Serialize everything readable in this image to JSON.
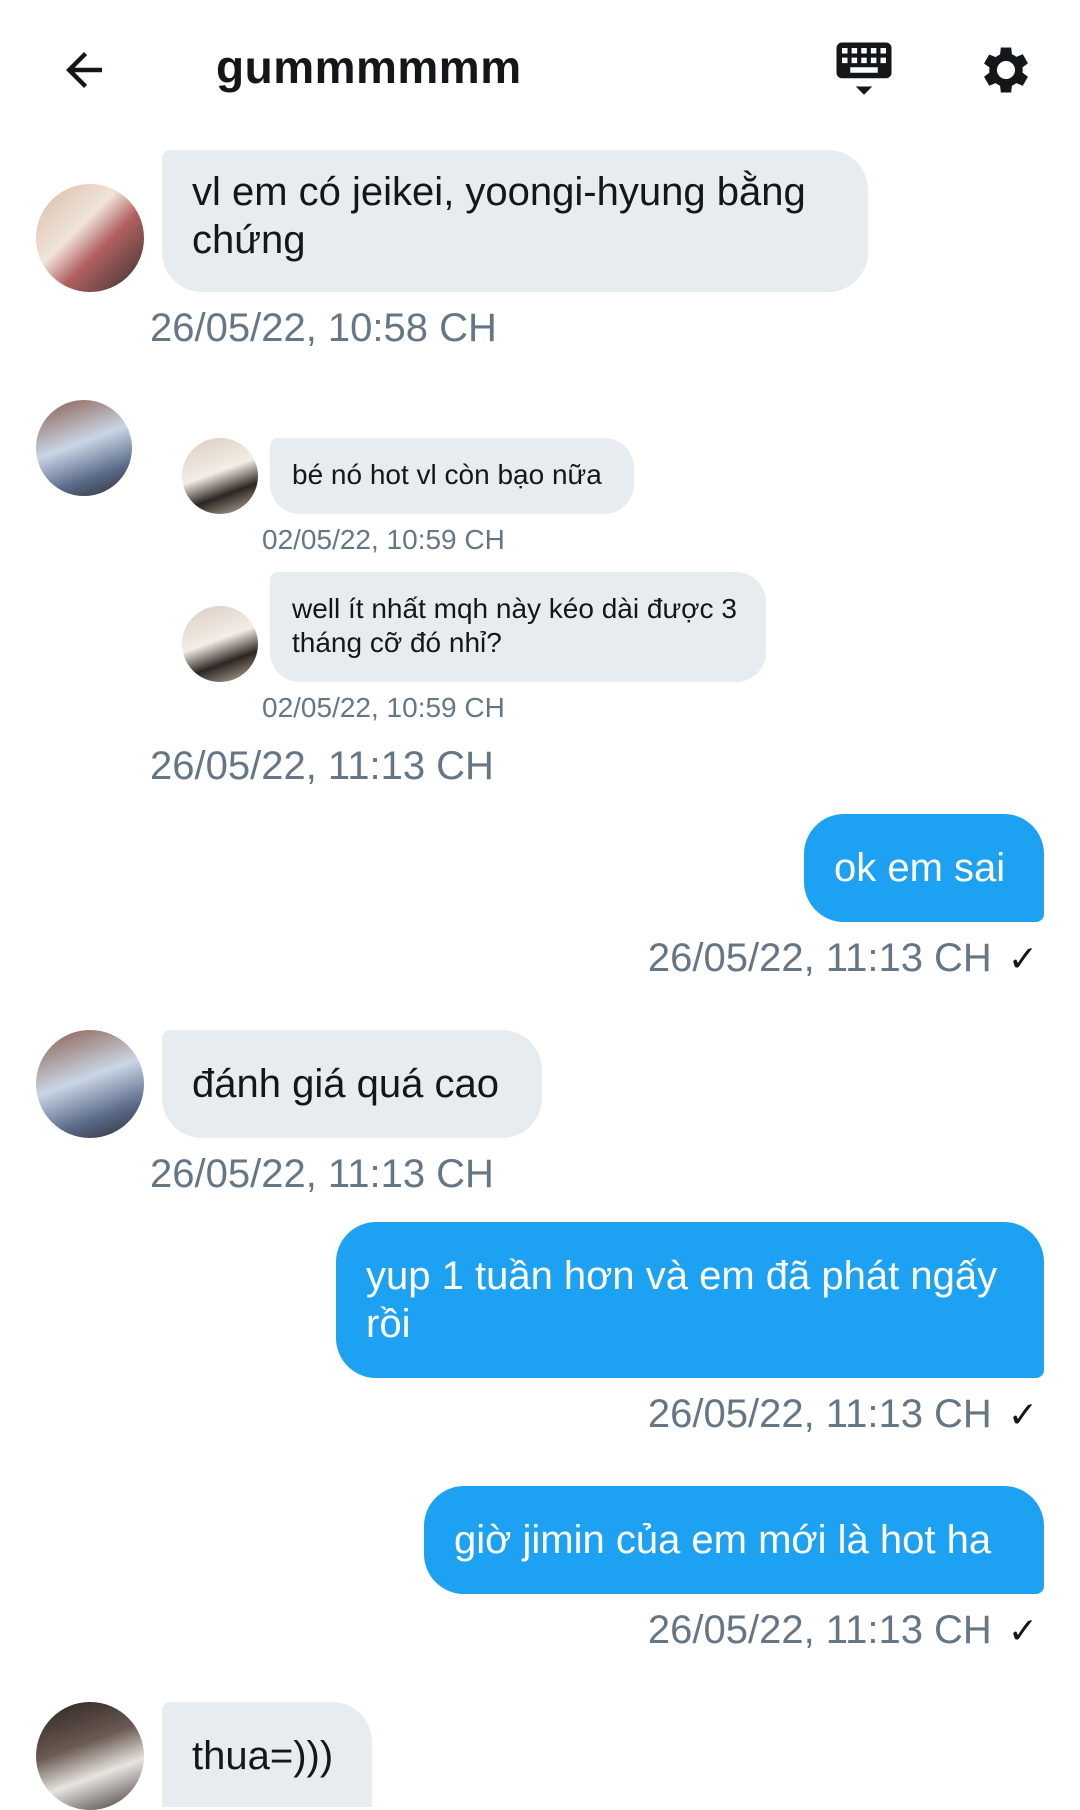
{
  "header": {
    "title": "gummmmmm",
    "back_icon": "arrow-left-icon",
    "keyboard_icon": "keyboard-icon",
    "settings_icon": "gear-icon"
  },
  "colors": {
    "incoming_bubble": "#e6ecf0",
    "outgoing_bubble": "#1da1f2",
    "timestamp": "#657786"
  },
  "messages": [
    {
      "direction": "in",
      "text": "vl em có jeikei, yoongi-hyung bằng chứng",
      "timestamp": "26/05/22, 10:58 CH"
    },
    {
      "direction": "in",
      "type": "shared",
      "quoted": [
        {
          "text": "bé nó hot vl còn bạo nữa",
          "timestamp": "02/05/22, 10:59 CH"
        },
        {
          "text": "well ít nhất mqh này kéo dài được 3 tháng cỡ đó nhỉ?",
          "timestamp": "02/05/22, 10:59 CH"
        }
      ],
      "timestamp": "26/05/22, 11:13 CH"
    },
    {
      "direction": "out",
      "text": "ok em sai",
      "timestamp": "26/05/22, 11:13 CH",
      "status": "✓"
    },
    {
      "direction": "in",
      "text": "đánh giá quá cao",
      "timestamp": "26/05/22, 11:13 CH"
    },
    {
      "direction": "out",
      "text": "yup 1 tuần hơn và em đã phát ngấy rồi",
      "timestamp": "26/05/22, 11:13 CH",
      "status": "✓"
    },
    {
      "direction": "out",
      "text": "giờ jimin của em mới là hot ha",
      "timestamp": "26/05/22, 11:13 CH",
      "status": "✓"
    },
    {
      "direction": "in",
      "text": "thua=)))"
    }
  ]
}
